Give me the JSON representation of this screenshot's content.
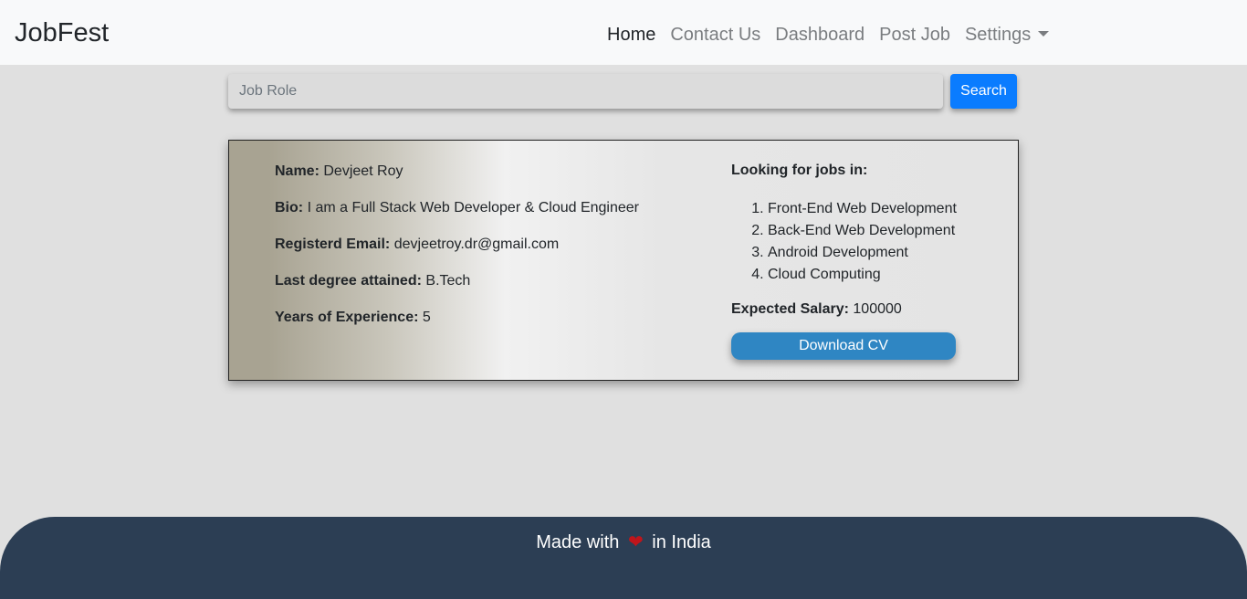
{
  "navbar": {
    "brand": "JobFest",
    "links": [
      {
        "label": "Home",
        "active": true
      },
      {
        "label": "Contact Us"
      },
      {
        "label": "Dashboard"
      },
      {
        "label": "Post Job"
      },
      {
        "label": "Settings",
        "dropdown": true
      }
    ]
  },
  "search": {
    "placeholder": "Job Role",
    "value": "",
    "button_label": "Search"
  },
  "profile": {
    "name_label": "Name:",
    "name_value": "Devjeet Roy",
    "bio_label": "Bio:",
    "bio_value": "I am a Full Stack Web Developer & Cloud Engineer",
    "email_label": "Registerd Email:",
    "email_value": "devjeetroy.dr@gmail.com",
    "degree_label": "Last degree attained:",
    "degree_value": "B.Tech",
    "experience_label": "Years of Experience:",
    "experience_value": "5",
    "looking_heading": "Looking for jobs in:",
    "job_areas": [
      "Front-End Web Development",
      "Back-End Web Development",
      "Android Development",
      "Cloud Computing"
    ],
    "salary_label": "Expected Salary:",
    "salary_value": "100000",
    "download_label": "Download CV"
  },
  "footer": {
    "text_before": "Made with",
    "icon": "heart-icon",
    "text_after": "in India"
  },
  "colors": {
    "accent": "#0a7cff",
    "cv_button": "#2f86c3",
    "footer_bg": "#2c3e54",
    "heart": "#c0151b"
  }
}
